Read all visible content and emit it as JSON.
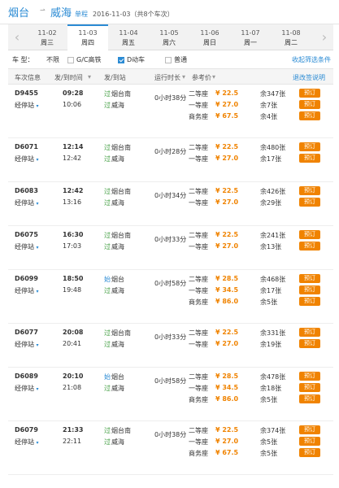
{
  "header": {
    "from": "烟台",
    "arrow": "⇀",
    "to": "威海",
    "trip_type": "单程",
    "date_info": "2016-11-03（共8个车次）"
  },
  "tabs": [
    {
      "date": "11-02",
      "weekday": "周三"
    },
    {
      "date": "11-03",
      "weekday": "周四"
    },
    {
      "date": "11-04",
      "weekday": "周五"
    },
    {
      "date": "11-05",
      "weekday": "周六"
    },
    {
      "date": "11-06",
      "weekday": "周日"
    },
    {
      "date": "11-07",
      "weekday": "周一"
    },
    {
      "date": "11-08",
      "weekday": "周二"
    }
  ],
  "nav": {
    "prev": "‹",
    "next": "›"
  },
  "filters": {
    "label": "车    型：",
    "options": [
      "不限",
      "G/C高铁",
      "D动车",
      "普通"
    ],
    "checked": [
      false,
      false,
      true,
      false
    ],
    "collapse": "收起筛选条件"
  },
  "columns": {
    "train": "车次信息",
    "time": "发/到时间",
    "time_sort": "▾",
    "station": "发/到站",
    "duration": "运行时长",
    "duration_sort": "▾",
    "price": "参考价",
    "price_sort": "▾",
    "rules": "退改签说明"
  },
  "trains": [
    {
      "no": "D9455",
      "stops": "经停站",
      "dep": "09:28",
      "arr": "10:06",
      "from_tag": "过",
      "from": "烟台南",
      "to_tag": "过",
      "to": "威海",
      "duration": "0小时38分",
      "seats": [
        {
          "name": "二等座",
          "price": "¥ 22.5",
          "remain": "余347张"
        },
        {
          "name": "一等座",
          "price": "¥ 27.0",
          "remain": "余7张"
        },
        {
          "name": "商务座",
          "price": "¥ 67.5",
          "remain": "余4张"
        }
      ]
    },
    {
      "no": "D6071",
      "stops": "经停站",
      "dep": "12:14",
      "arr": "12:42",
      "from_tag": "过",
      "from": "烟台南",
      "to_tag": "过",
      "to": "威海",
      "duration": "0小时28分",
      "seats": [
        {
          "name": "二等座",
          "price": "¥ 22.5",
          "remain": "余480张"
        },
        {
          "name": "一等座",
          "price": "¥ 27.0",
          "remain": "余17张"
        }
      ]
    },
    {
      "no": "D6083",
      "stops": "经停站",
      "dep": "12:42",
      "arr": "13:16",
      "from_tag": "过",
      "from": "烟台南",
      "to_tag": "过",
      "to": "威海",
      "duration": "0小时34分",
      "seats": [
        {
          "name": "二等座",
          "price": "¥ 22.5",
          "remain": "余426张"
        },
        {
          "name": "一等座",
          "price": "¥ 27.0",
          "remain": "余29张"
        }
      ]
    },
    {
      "no": "D6075",
      "stops": "经停站",
      "dep": "16:30",
      "arr": "17:03",
      "from_tag": "过",
      "from": "烟台南",
      "to_tag": "过",
      "to": "威海",
      "duration": "0小时33分",
      "seats": [
        {
          "name": "二等座",
          "price": "¥ 22.5",
          "remain": "余241张"
        },
        {
          "name": "一等座",
          "price": "¥ 27.0",
          "remain": "余13张"
        }
      ]
    },
    {
      "no": "D6099",
      "stops": "经停站",
      "dep": "18:50",
      "arr": "19:48",
      "from_tag": "始",
      "from": "烟台",
      "to_tag": "过",
      "to": "威海",
      "duration": "0小时58分",
      "seats": [
        {
          "name": "二等座",
          "price": "¥ 28.5",
          "remain": "余468张"
        },
        {
          "name": "一等座",
          "price": "¥ 34.5",
          "remain": "余17张"
        },
        {
          "name": "商务座",
          "price": "¥ 86.0",
          "remain": "余5张"
        }
      ]
    },
    {
      "no": "D6077",
      "stops": "经停站",
      "dep": "20:08",
      "arr": "20:41",
      "from_tag": "过",
      "from": "烟台南",
      "to_tag": "过",
      "to": "威海",
      "duration": "0小时33分",
      "seats": [
        {
          "name": "二等座",
          "price": "¥ 22.5",
          "remain": "余331张"
        },
        {
          "name": "一等座",
          "price": "¥ 27.0",
          "remain": "余19张"
        }
      ]
    },
    {
      "no": "D6089",
      "stops": "经停站",
      "dep": "20:10",
      "arr": "21:08",
      "from_tag": "始",
      "from": "烟台",
      "to_tag": "过",
      "to": "威海",
      "duration": "0小时58分",
      "seats": [
        {
          "name": "二等座",
          "price": "¥ 28.5",
          "remain": "余478张"
        },
        {
          "name": "一等座",
          "price": "¥ 34.5",
          "remain": "余18张"
        },
        {
          "name": "商务座",
          "price": "¥ 86.0",
          "remain": "余5张"
        }
      ]
    },
    {
      "no": "D6079",
      "stops": "经停站",
      "dep": "21:33",
      "arr": "22:11",
      "from_tag": "过",
      "from": "烟台南",
      "to_tag": "过",
      "to": "威海",
      "duration": "0小时38分",
      "seats": [
        {
          "name": "二等座",
          "price": "¥ 22.5",
          "remain": "余374张"
        },
        {
          "name": "一等座",
          "price": "¥ 27.0",
          "remain": "余5张"
        },
        {
          "name": "商务座",
          "price": "¥ 67.5",
          "remain": "余5张"
        }
      ]
    }
  ],
  "book_label": "预订",
  "stops_caret": "▾"
}
